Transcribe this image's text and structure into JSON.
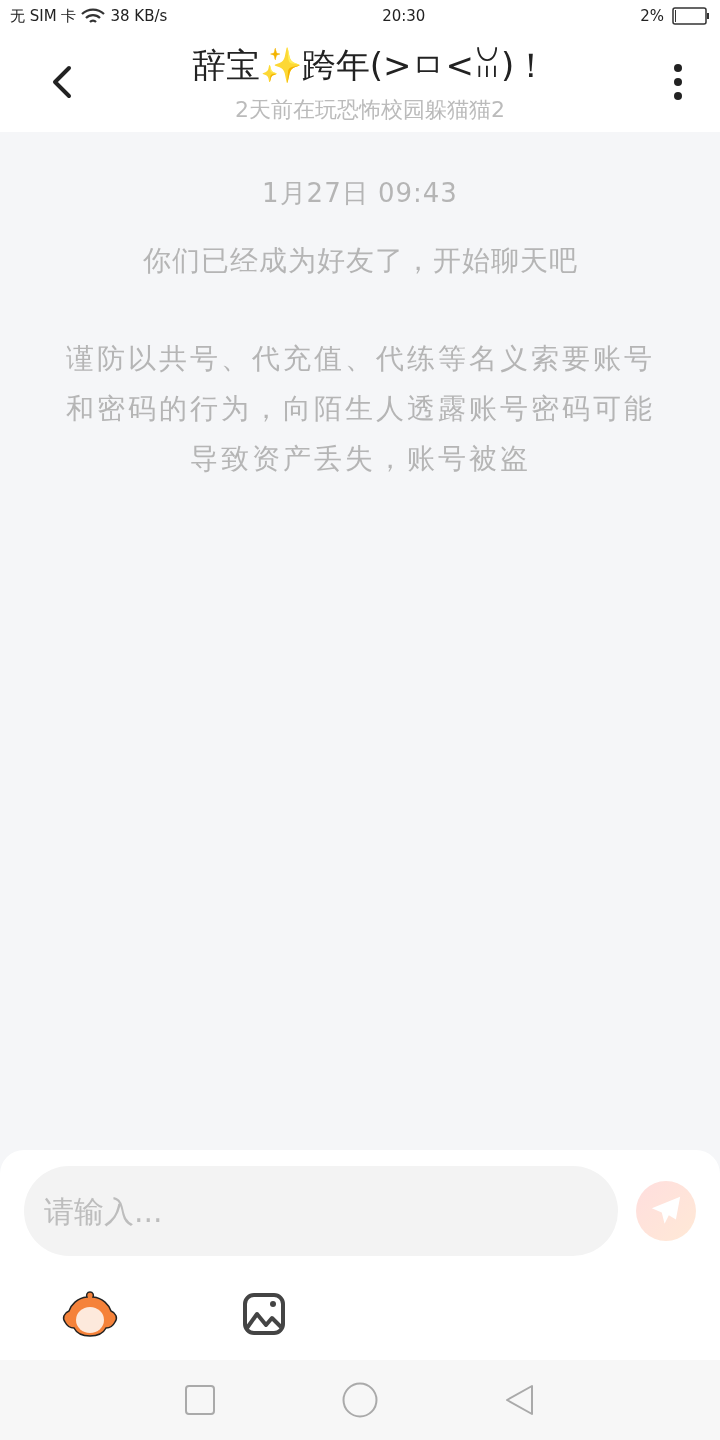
{
  "status_bar": {
    "carrier": "无 SIM 卡",
    "speed": "38 KB/s",
    "time": "20:30",
    "battery": "2%"
  },
  "header": {
    "title": "辞宝✨跨年(>ㅁ<ꈍ)！",
    "subtitle": "2天前在玩恐怖校园躲猫猫2"
  },
  "messages": [
    {
      "kind": "time",
      "text": "1月27日 09:43"
    },
    {
      "kind": "notice",
      "text": "你们已经成为好友了，开始聊天吧"
    },
    {
      "kind": "warning",
      "text": "谨防以共号、代充值、代练等名义索要账号和密码的行为，向陌生人透露账号密码可能导致资产丢失，账号被盗"
    }
  ],
  "composer": {
    "placeholder": "请输入..."
  }
}
